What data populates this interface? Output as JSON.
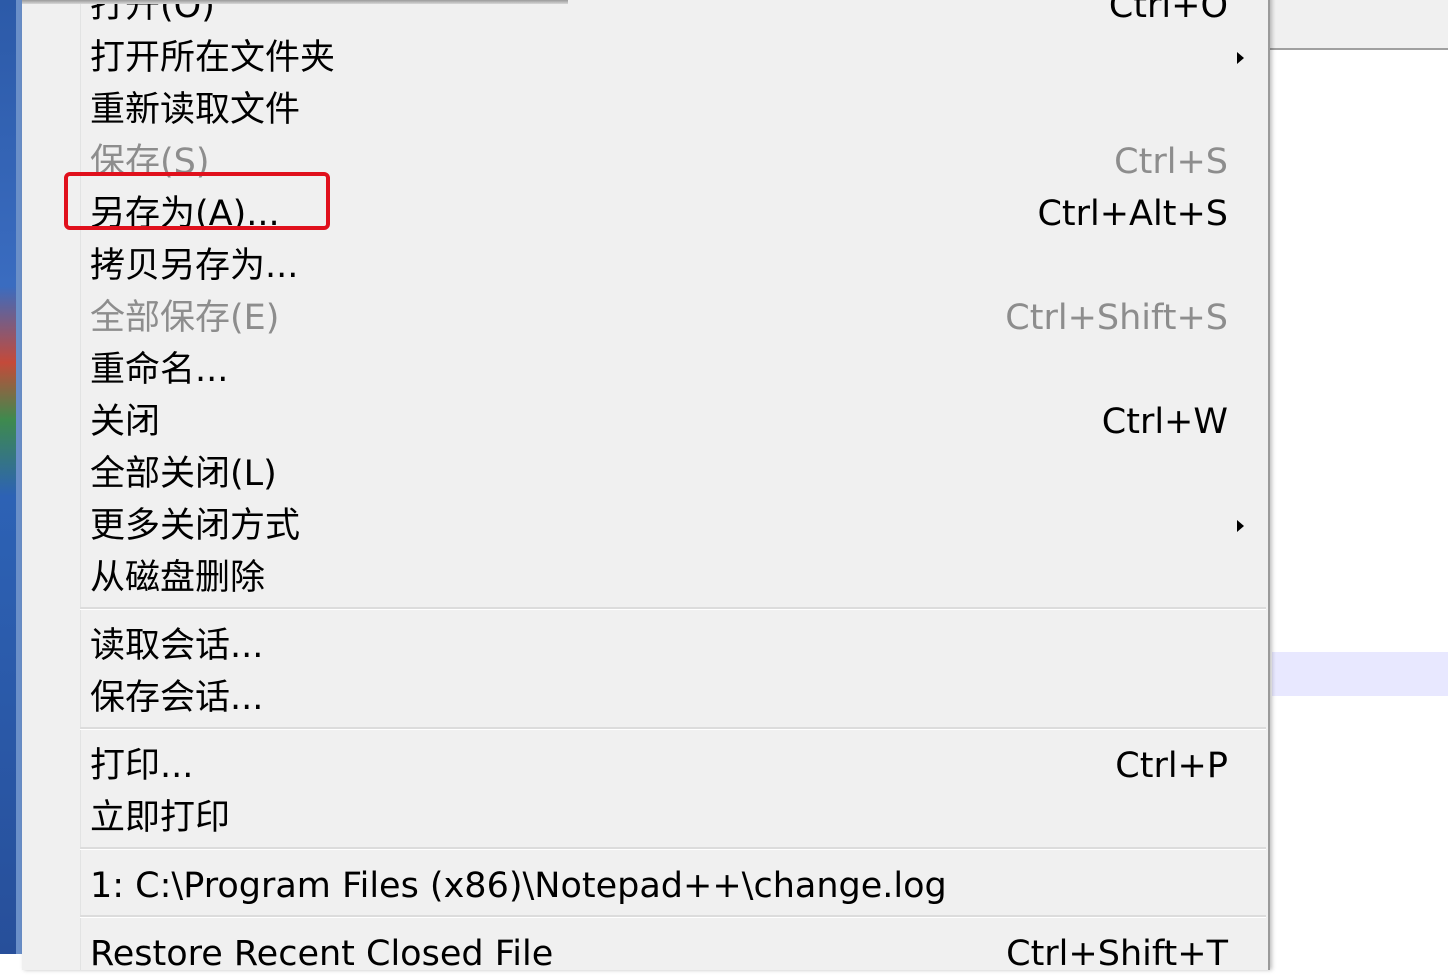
{
  "menu": {
    "items": [
      {
        "label": "打开(O)",
        "shortcut": "Ctrl+O"
      },
      {
        "label": "打开所在文件夹",
        "shortcut": ""
      },
      {
        "label": "重新读取文件",
        "shortcut": ""
      },
      {
        "label": "保存(S)",
        "shortcut": "Ctrl+S"
      },
      {
        "label": "另存为(A)...",
        "shortcut": "Ctrl+Alt+S"
      },
      {
        "label": "拷贝另存为...",
        "shortcut": ""
      },
      {
        "label": "全部保存(E)",
        "shortcut": "Ctrl+Shift+S"
      },
      {
        "label": "重命名...",
        "shortcut": ""
      },
      {
        "label": "关闭",
        "shortcut": "Ctrl+W"
      },
      {
        "label": "全部关闭(L)",
        "shortcut": ""
      },
      {
        "label": "更多关闭方式",
        "shortcut": ""
      },
      {
        "label": "从磁盘删除",
        "shortcut": ""
      },
      {
        "label": "读取会话...",
        "shortcut": ""
      },
      {
        "label": "保存会话...",
        "shortcut": ""
      },
      {
        "label": "打印...",
        "shortcut": "Ctrl+P"
      },
      {
        "label": "立即打印",
        "shortcut": ""
      },
      {
        "label": "1: C:\\Program Files (x86)\\Notepad++\\change.log",
        "shortcut": ""
      },
      {
        "label": "Restore Recent Closed File",
        "shortcut": "Ctrl+Shift+T"
      }
    ]
  },
  "colors": {
    "menu_background": "#f0f0f0",
    "disabled_text": "#8d8d8d",
    "highlight_border": "#e0101c"
  }
}
